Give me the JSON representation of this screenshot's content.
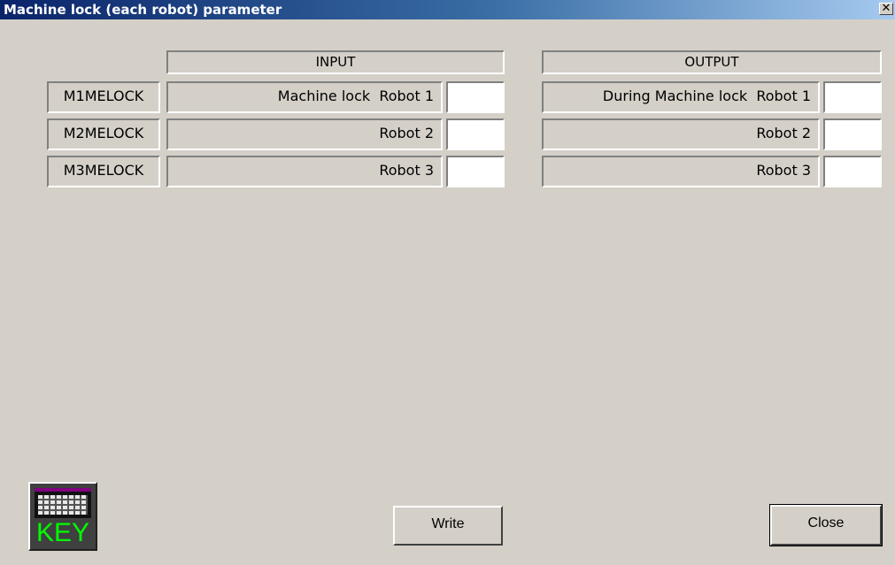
{
  "window": {
    "title": "Machine lock (each robot) parameter",
    "close_glyph": "✕"
  },
  "input": {
    "header": "INPUT",
    "rows": [
      {
        "signal": "M1MELOCK",
        "label": "Machine lock  Robot 1",
        "value": ""
      },
      {
        "signal": "M2MELOCK",
        "label": "Robot 2",
        "value": ""
      },
      {
        "signal": "M3MELOCK",
        "label": "Robot 3",
        "value": ""
      }
    ]
  },
  "output": {
    "header": "OUTPUT",
    "rows": [
      {
        "label": "During Machine lock  Robot 1",
        "value": ""
      },
      {
        "label": "Robot 2",
        "value": ""
      },
      {
        "label": "Robot 3",
        "value": ""
      }
    ]
  },
  "keyboard_button": {
    "text": "KEY",
    "icon": "keyboard-icon",
    "text_color": "#00ff00"
  },
  "buttons": {
    "write": "Write",
    "close": "Close"
  },
  "colors": {
    "face": "#d4d0c8",
    "title_start": "#0a246a",
    "title_end": "#a6caf0"
  }
}
